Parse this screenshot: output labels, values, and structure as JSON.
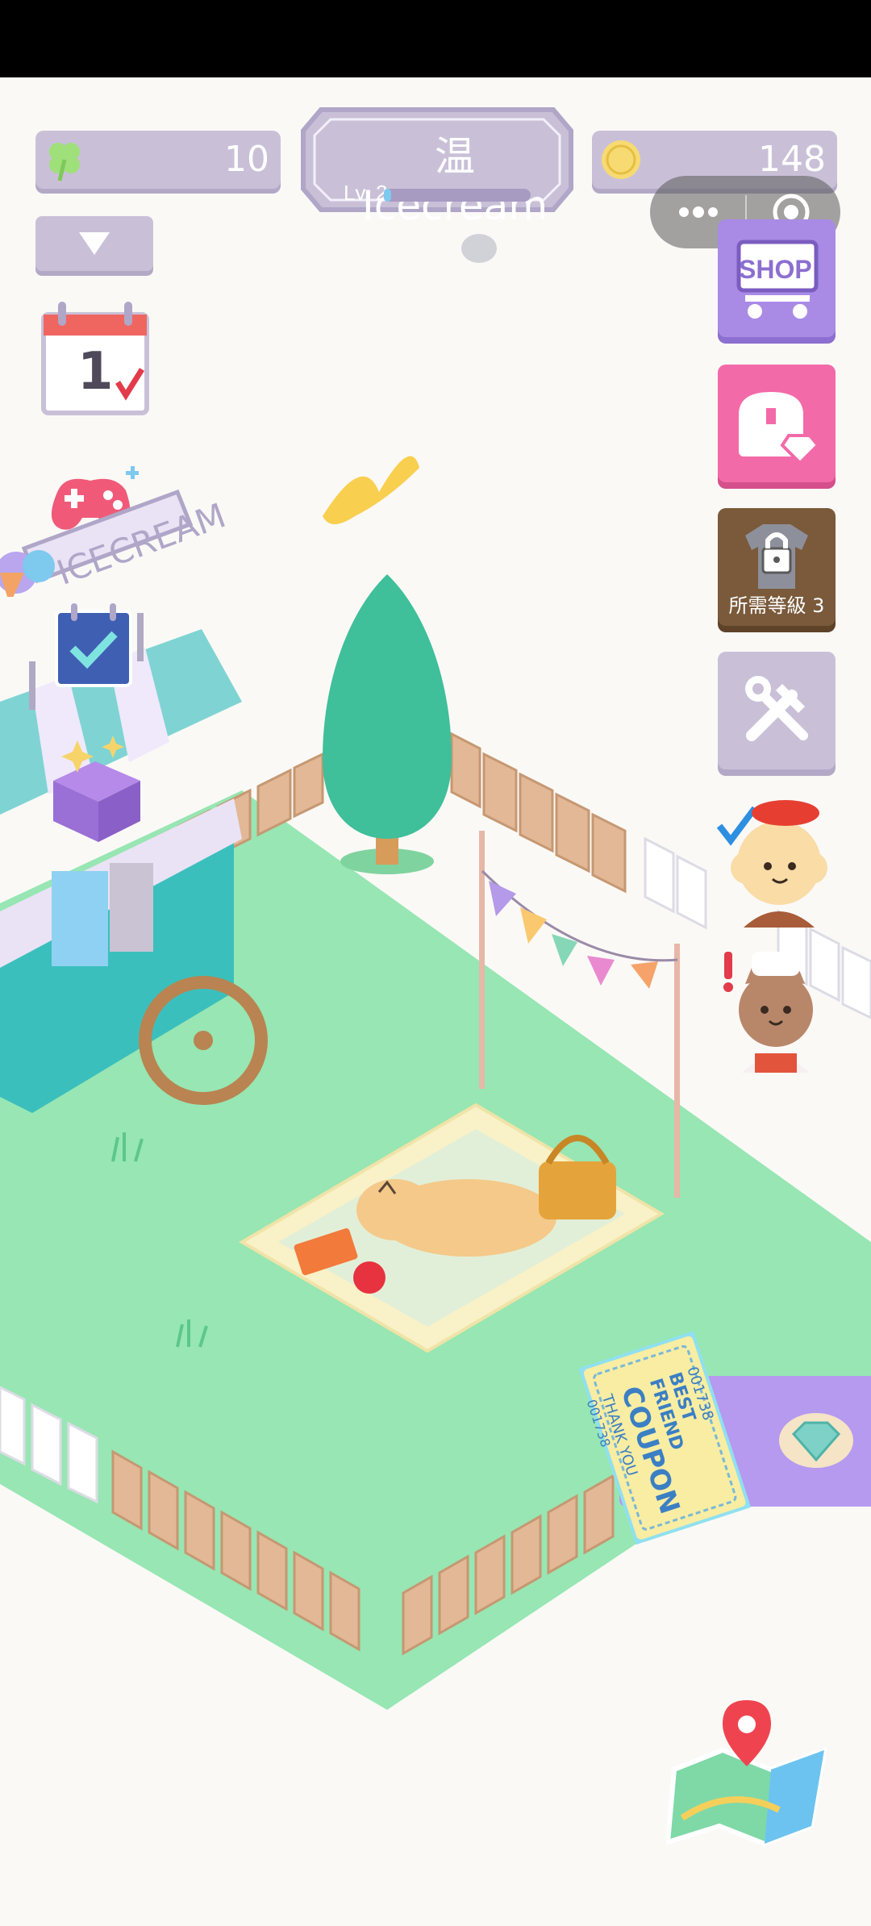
{
  "hud": {
    "clover_count": "10",
    "coin_count": "148",
    "player_name": "温 Icecream",
    "level_label": "Lv. 2",
    "level_progress": 0.05
  },
  "side_buttons": {
    "shop_label": "SHOP",
    "locked_label": "所需等級 3"
  },
  "cart": {
    "sign_text": "ICECREAM"
  },
  "calendar": {
    "day": "1"
  },
  "coupon": {
    "line1": "BEST FRIEND",
    "line2": "COUPON",
    "line3": "THANK YOU",
    "serial_top": "001738",
    "serial_bottom": "001738"
  },
  "icons": [
    "clover-icon",
    "coin-icon",
    "dropdown-icon",
    "calendar-icon",
    "gamepad-icon",
    "checklist-icon",
    "mystery-box-icon",
    "shop-icon",
    "gift-chest-icon",
    "locked-outfit-icon",
    "tools-icon",
    "map-icon",
    "gem-icon"
  ],
  "colors": {
    "grass": "#97e6b3",
    "hud_lavender": "#c9c0d8",
    "shop_purple": "#a98be6",
    "gift_pink": "#f36aa8",
    "lock_brown": "#7a5a3a"
  }
}
